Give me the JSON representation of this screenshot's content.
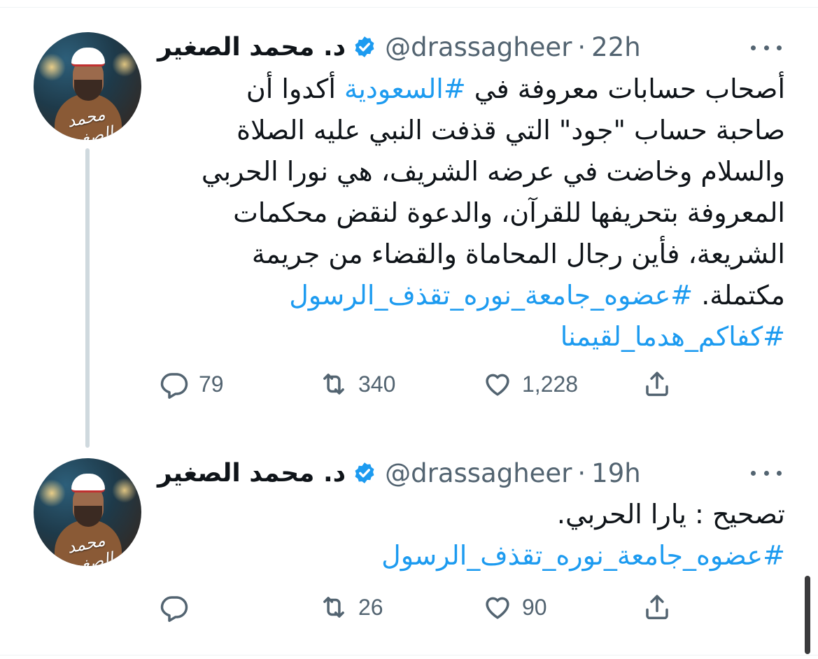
{
  "tweets": [
    {
      "author": "د. محمد الصغير",
      "handle": "@drassagheer",
      "separator": "·",
      "time": "22h",
      "avatar_signature": "محمد الصغير",
      "lines": [
        {
          "parts": [
            {
              "text": "أصحاب حسابات معروفة في ",
              "link": false
            },
            {
              "text": "#السعودية",
              "link": true
            },
            {
              "text": " أكدوا أن",
              "link": false
            }
          ]
        },
        {
          "parts": [
            {
              "text": "صاحبة حساب \"جود\" التي قذفت النبي عليه الصلاة",
              "link": false
            }
          ]
        },
        {
          "parts": [
            {
              "text": "والسلام وخاضت في عرضه الشريف، هي نورا الحربي",
              "link": false
            }
          ]
        },
        {
          "parts": [
            {
              "text": "المعروفة بتحريفها للقرآن، والدعوة لنقض محكمات",
              "link": false
            }
          ]
        },
        {
          "parts": [
            {
              "text": "الشريعة، فأين رجال المحاماة والقضاء من جريمة",
              "link": false
            }
          ]
        },
        {
          "parts": [
            {
              "text": "مكتملة. ",
              "link": false
            },
            {
              "text": "#عضوه_جامعة_نوره_تقذف_الرسول",
              "link": true
            }
          ]
        },
        {
          "parts": [
            {
              "text": "#كفاكم_هدما_لقيمنا",
              "link": true
            }
          ]
        }
      ],
      "replies": "79",
      "retweets": "340",
      "likes": "1,228"
    },
    {
      "author": "د. محمد الصغير",
      "handle": "@drassagheer",
      "separator": "·",
      "time": "19h",
      "avatar_signature": "محمد الصغير",
      "lines": [
        {
          "parts": [
            {
              "text": "تصحيح : يارا الحربي.",
              "link": false
            }
          ]
        },
        {
          "parts": [
            {
              "text": "#عضوه_جامعة_نوره_تقذف_الرسول",
              "link": true
            }
          ]
        }
      ],
      "replies": "",
      "retweets": "26",
      "likes": "90"
    }
  ],
  "icons": {
    "reply": "reply-icon",
    "retweet": "retweet-icon",
    "like": "like-icon",
    "share": "share-icon",
    "verified": "verified-badge-icon",
    "more": "more-icon"
  },
  "colors": {
    "link": "#1d9bf0",
    "secondary_text": "#536471",
    "verified": "#1d9bf0",
    "thread_line": "#cfd9de"
  }
}
